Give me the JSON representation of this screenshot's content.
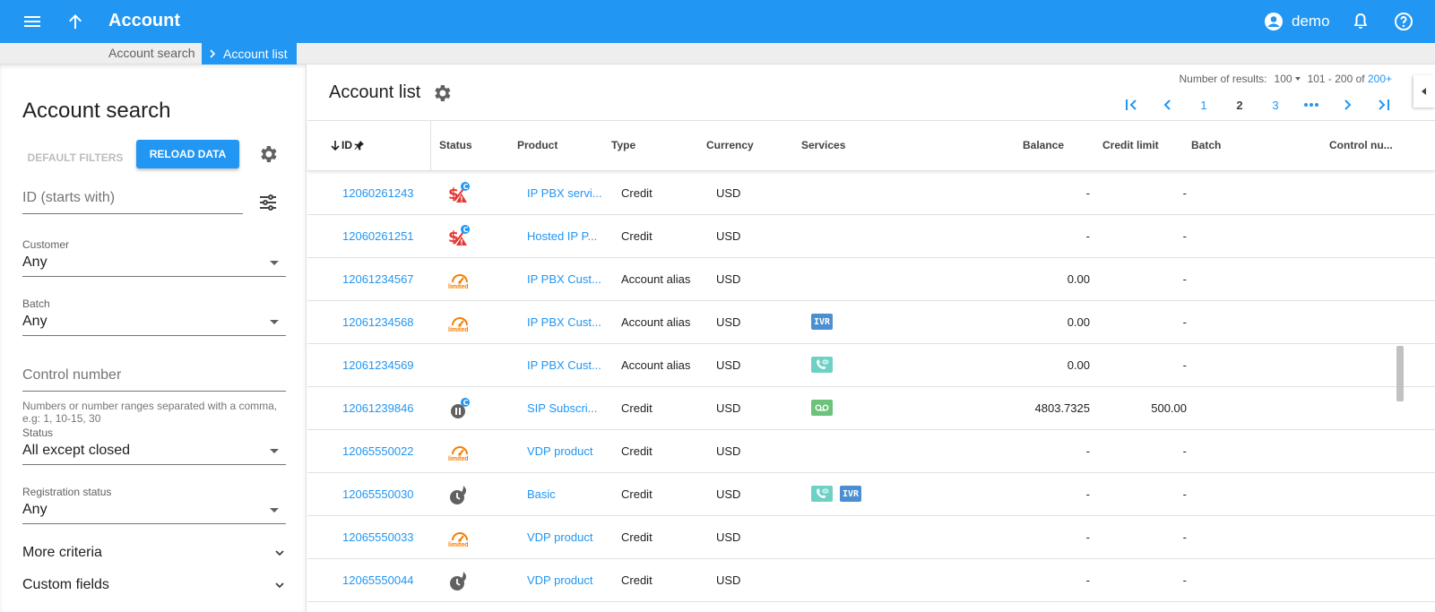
{
  "header": {
    "title": "Account",
    "user": "demo"
  },
  "breadcrumb": {
    "items": [
      "Account search",
      "Account list"
    ]
  },
  "left_panel": {
    "title": "Account search",
    "default_filters_label": "DEFAULT FILTERS",
    "reload_label": "RELOAD DATA",
    "id_placeholder": "ID (starts with)",
    "customer": {
      "label": "Customer",
      "value": "Any"
    },
    "batch": {
      "label": "Batch",
      "value": "Any"
    },
    "control_placeholder": "Control number",
    "control_hint": "Numbers or number ranges separated with a comma, e.g: 1, 10-15, 30",
    "status": {
      "label": "Status",
      "value": "All except closed"
    },
    "registration": {
      "label": "Registration status",
      "value": "Any"
    },
    "more_criteria": "More criteria",
    "custom_fields": "Custom fields"
  },
  "main": {
    "title": "Account list",
    "results_label": "Number of results:",
    "results_per_page": "100",
    "range_text": "101 - 200 of",
    "range_total": "200+",
    "pages": [
      "1",
      "2",
      "3"
    ],
    "current_page": "2",
    "columns": {
      "id": "ID",
      "status": "Status",
      "product": "Product",
      "type": "Type",
      "currency": "Currency",
      "services": "Services",
      "balance": "Balance",
      "credit_limit": "Credit limit",
      "batch": "Batch",
      "control": "Control nu..."
    },
    "rows": [
      {
        "id": "12060261243",
        "status": "credit-exceeded-warning-icon",
        "product": "IP PBX servi...",
        "type": "Credit",
        "currency": "USD",
        "services": [],
        "balance": "-",
        "credit_limit": "-"
      },
      {
        "id": "12060261251",
        "status": "credit-exceeded-warning-icon",
        "product": "Hosted IP P...",
        "type": "Credit",
        "currency": "USD",
        "services": [],
        "balance": "-",
        "credit_limit": "-"
      },
      {
        "id": "12061234567",
        "status": "limited-icon",
        "product": "IP PBX Cust...",
        "type": "Account alias",
        "currency": "USD",
        "services": [],
        "balance": "0.00",
        "credit_limit": "-"
      },
      {
        "id": "12061234568",
        "status": "limited-icon",
        "product": "IP PBX Cust...",
        "type": "Account alias",
        "currency": "USD",
        "services": [
          "IVR"
        ],
        "balance": "0.00",
        "credit_limit": "-"
      },
      {
        "id": "12061234569",
        "status": "",
        "product": "IP PBX Cust...",
        "type": "Account alias",
        "currency": "USD",
        "services": [
          "call"
        ],
        "balance": "0.00",
        "credit_limit": "-"
      },
      {
        "id": "12061239846",
        "status": "suspended-icon",
        "product": "SIP Subscri...",
        "type": "Credit",
        "currency": "USD",
        "services": [
          "voicemail"
        ],
        "balance": "4803.7325",
        "credit_limit": "500.00"
      },
      {
        "id": "12065550022",
        "status": "limited-icon",
        "product": "VDP product",
        "type": "Credit",
        "currency": "USD",
        "services": [],
        "balance": "-",
        "credit_limit": "-"
      },
      {
        "id": "12065550030",
        "status": "expired-icon",
        "product": "Basic",
        "type": "Credit",
        "currency": "USD",
        "services": [
          "call",
          "IVR"
        ],
        "balance": "-",
        "credit_limit": "-"
      },
      {
        "id": "12065550033",
        "status": "limited-icon",
        "product": "VDP product",
        "type": "Credit",
        "currency": "USD",
        "services": [],
        "balance": "-",
        "credit_limit": "-"
      },
      {
        "id": "12065550044",
        "status": "expired-icon",
        "product": "VDP product",
        "type": "Credit",
        "currency": "USD",
        "services": [],
        "balance": "-",
        "credit_limit": "-"
      }
    ],
    "limited_label": "limited"
  },
  "colors": {
    "primary": "#2196f3",
    "warning": "#e53935",
    "limited": "#f57c00",
    "grey_icon": "#616161"
  }
}
